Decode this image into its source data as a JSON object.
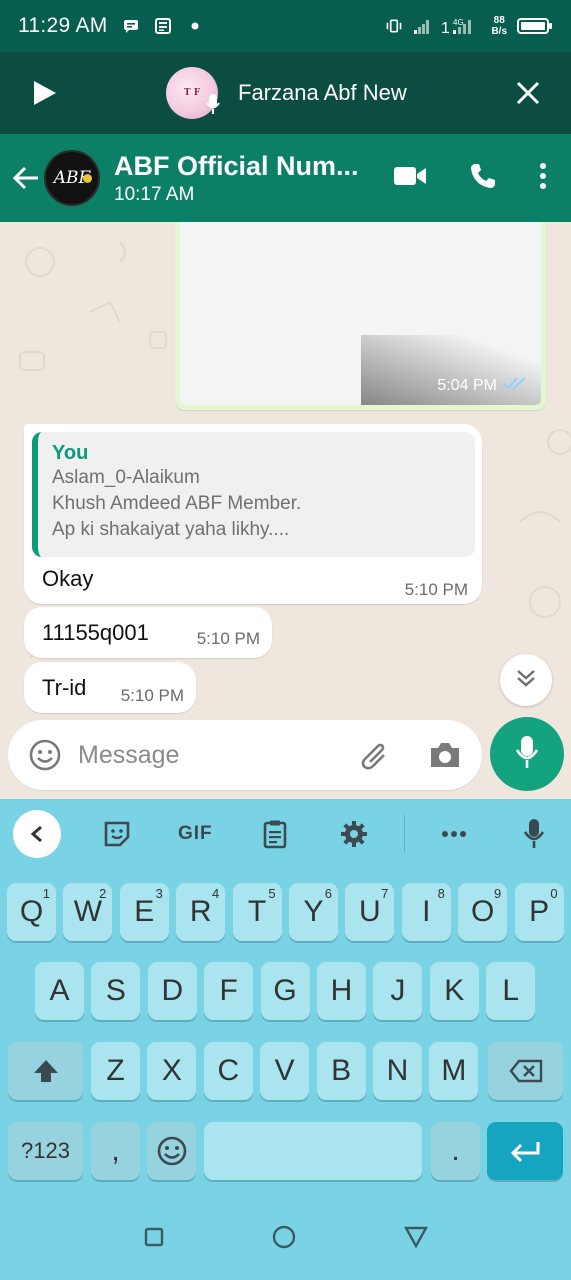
{
  "status_bar": {
    "time": "11:29 AM",
    "net_speed_value": "88",
    "net_speed_unit": "B/s",
    "network": "4G"
  },
  "voice_bar": {
    "contact_name": "Farzana Abf New"
  },
  "chat_header": {
    "title": "ABF Official Num...",
    "subtitle": "10:17 AM",
    "avatar_text": "ABF"
  },
  "messages": {
    "image_time": "5:04 PM",
    "reply": {
      "quoted_author": "You",
      "quoted_lines": [
        "Aslam_0-Alaikum",
        "Khush Amdeed ABF Member.",
        "Ap ki shakaiyat yaha likhy...."
      ],
      "text": "Okay",
      "time": "5:10 PM"
    },
    "msg2": {
      "text": "11155q001",
      "time": "5:10 PM"
    },
    "msg3": {
      "text": "Tr-id",
      "time": "5:10 PM"
    }
  },
  "input": {
    "placeholder": "Message"
  },
  "keyboard": {
    "toolbar_gif": "GIF",
    "row1": [
      {
        "k": "Q",
        "h": "1"
      },
      {
        "k": "W",
        "h": "2"
      },
      {
        "k": "E",
        "h": "3"
      },
      {
        "k": "R",
        "h": "4"
      },
      {
        "k": "T",
        "h": "5"
      },
      {
        "k": "Y",
        "h": "6"
      },
      {
        "k": "U",
        "h": "7"
      },
      {
        "k": "I",
        "h": "8"
      },
      {
        "k": "O",
        "h": "9"
      },
      {
        "k": "P",
        "h": "0"
      }
    ],
    "row2": [
      "A",
      "S",
      "D",
      "F",
      "G",
      "H",
      "J",
      "K",
      "L"
    ],
    "row3": [
      "Z",
      "X",
      "C",
      "V",
      "B",
      "N",
      "M"
    ],
    "sym_key": "?123",
    "comma_key": ",",
    "period_key": "."
  },
  "colors": {
    "status_bar": "#075e4f",
    "header": "#0b8067",
    "accent": "#0b9b7a",
    "mic_button": "#14a37f",
    "keyboard_bg": "#7ad3e4",
    "enter_key": "#16a5c0"
  }
}
